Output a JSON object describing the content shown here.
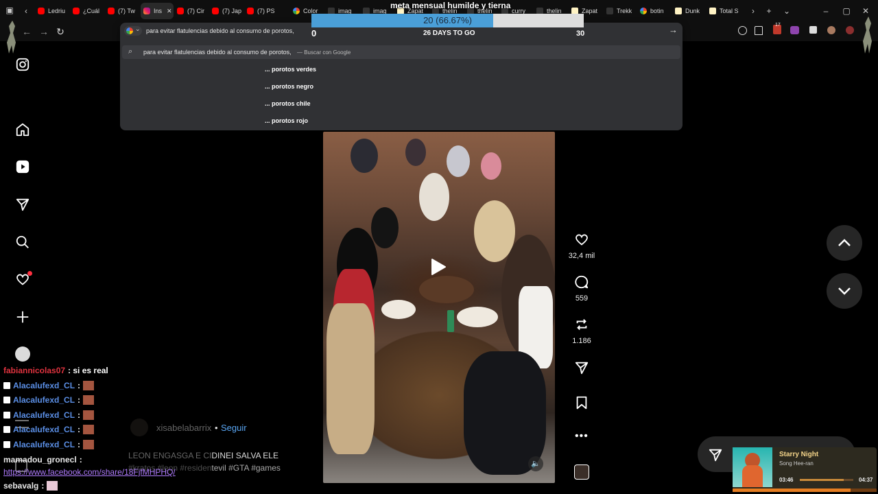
{
  "browser": {
    "tabs": [
      {
        "label": "Ledriu",
        "favicon": "youtube-icon"
      },
      {
        "label": "¿Cuál",
        "favicon": "youtube-icon"
      },
      {
        "label": "(7) Tw",
        "favicon": "youtube-icon"
      },
      {
        "label": "Ins",
        "favicon": "instagram-icon",
        "active": true
      },
      {
        "label": "(7) Cir",
        "favicon": "youtube-icon"
      },
      {
        "label": "(7) Jap",
        "favicon": "youtube-icon"
      },
      {
        "label": "(7) PS",
        "favicon": "youtube-icon"
      },
      {
        "label": "Color",
        "favicon": "colorwheel-icon"
      },
      {
        "label": "imag",
        "favicon": "generic-icon"
      },
      {
        "label": "imag",
        "favicon": "generic-icon"
      },
      {
        "label": "Zapat",
        "favicon": "doc-icon"
      },
      {
        "label": "thelin",
        "favicon": "generic-icon"
      },
      {
        "label": "thelin",
        "favicon": "generic-icon"
      },
      {
        "label": "curry",
        "favicon": "generic-icon"
      },
      {
        "label": "thelin",
        "favicon": "generic-icon"
      },
      {
        "label": "Zapat",
        "favicon": "doc-icon"
      },
      {
        "label": "Trekk",
        "favicon": "dark-icon"
      },
      {
        "label": "botin",
        "favicon": "google-icon"
      },
      {
        "label": "Dunk",
        "favicon": "doc-icon"
      },
      {
        "label": "Total S",
        "favicon": "doc-icon"
      }
    ],
    "omnibox": {
      "query": "para evitar flatulencias debido al consumo de porotos,",
      "first_suggestion": "para evitar flatulencias debido al consumo de porotos,",
      "first_suggestion_hint": "— Buscar con Google",
      "suggestions": [
        "... porotos verdes",
        "... porotos negro",
        "... porotos chile",
        "... porotos rojo"
      ]
    },
    "extension_badge": "17"
  },
  "stream_goal": {
    "title": "meta mensual humilde y tierna",
    "progress_label": "20 (66.67%)",
    "progress": 0.6667,
    "min": "0",
    "max": "30",
    "days_label": "26 DAYS TO GO"
  },
  "reel": {
    "likes": "32,4 mil",
    "comments": "559",
    "reposts": "1.186",
    "author": "xisabelabarrix",
    "follow_label": "Seguir",
    "separator": "•",
    "caption": "LEON ENGASGA E CIDINEI SALVA ELE",
    "hashtags": "#kratos #leon #residentevil #GTA #games"
  },
  "chat": [
    {
      "user": "fabiannicolas07",
      "user_color": "#e0333f",
      "text": ": si es real",
      "badge": false
    },
    {
      "user": "Alacalufexd_CL",
      "user_color": "#5b8fe6",
      "text": ":",
      "badge": true
    },
    {
      "user": "Alacalufexd_CL",
      "user_color": "#5b8fe6",
      "text": ":",
      "badge": true
    },
    {
      "user": "Alacalufexd_CL",
      "user_color": "#5b8fe6",
      "text": ":",
      "badge": true
    },
    {
      "user": "Alacalufexd_CL",
      "user_color": "#5b8fe6",
      "text": ":",
      "badge": true
    },
    {
      "user": "Alacalufexd_CL",
      "user_color": "#5b8fe6",
      "text": ":",
      "badge": true
    },
    {
      "user": "mamadou_gronecl",
      "user_color": "#e8e8e8",
      "text": ":",
      "badge": false
    },
    {
      "user": "https://www.facebook.com/share/18FjfMHPHQ/",
      "user_color": "#b07cff",
      "text": "",
      "badge": false
    },
    {
      "user": "sebavalg",
      "user_color": "#e8e8e8",
      "text": ":",
      "badge": false
    }
  ],
  "music": {
    "title": "Starry Night",
    "artist": "Song Hee-ran",
    "elapsed": "03:46",
    "total": "04:37",
    "progress": 0.82
  }
}
